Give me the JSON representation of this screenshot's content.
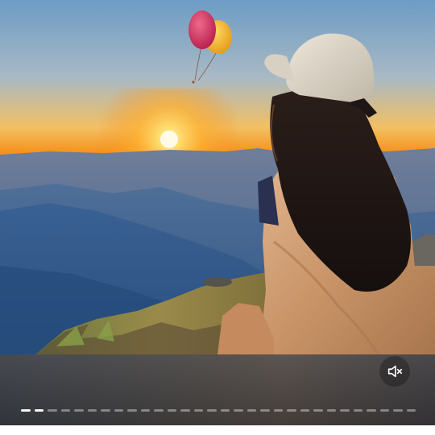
{
  "media": {
    "description_icon": "photo",
    "colors": {
      "sky_top": "#7aa6c9",
      "sunset_orange": "#f59a1a",
      "sun": "#fff2a0",
      "mountains": "#3e5f86",
      "balloon_red": "#d0285a",
      "balloon_yellow": "#f2b21e",
      "cap": "#d9d2c4",
      "hair": "#1e1614",
      "sweater": "#c9966c"
    }
  },
  "controls": {
    "mute_icon": "speaker-muted-icon",
    "colors": {
      "bar_bg": "#474444",
      "segment_active": "#ffffff",
      "segment_inactive": "#8a8684"
    }
  },
  "progress": {
    "total_segments": 30,
    "active_segments": 2
  }
}
